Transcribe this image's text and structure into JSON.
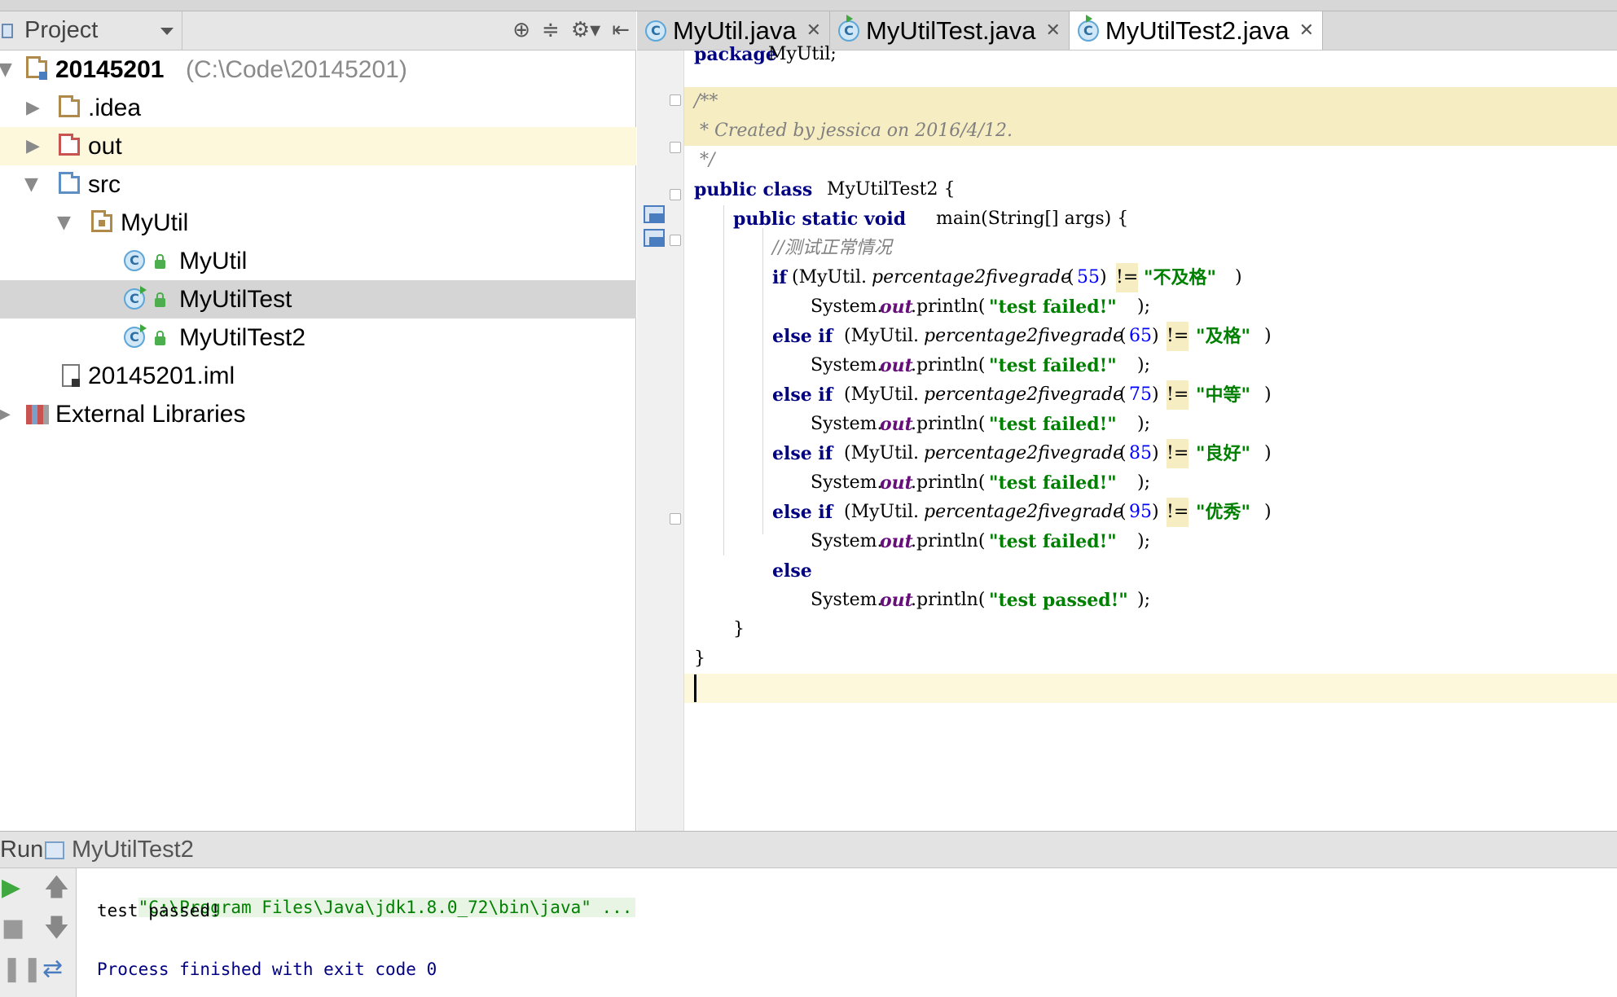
{
  "project_panel": {
    "title": "Project",
    "toolbar_icons": [
      "locate-icon",
      "collapse-icon",
      "gear-icon",
      "hide-icon"
    ],
    "tree": [
      {
        "label": "20145201",
        "path": "(C:\\Code\\20145201)",
        "type": "module-folder",
        "expanded": true
      },
      {
        "label": ".idea",
        "type": "folder",
        "expanded": false
      },
      {
        "label": "out",
        "type": "excluded-folder",
        "expanded": false,
        "highlighted": true
      },
      {
        "label": "src",
        "type": "source-folder",
        "expanded": true
      },
      {
        "label": "MyUtil",
        "type": "package",
        "expanded": true
      },
      {
        "label": "MyUtil",
        "type": "class"
      },
      {
        "label": "MyUtilTest",
        "type": "runnable-class",
        "selected": true
      },
      {
        "label": "MyUtilTest2",
        "type": "runnable-class"
      },
      {
        "label": "20145201.iml",
        "type": "iml-file"
      },
      {
        "label": "External Libraries",
        "type": "libraries",
        "expanded": false
      }
    ]
  },
  "editor_tabs": [
    {
      "label": "MyUtil.java",
      "icon": "class-icon",
      "active": false
    },
    {
      "label": "MyUtilTest.java",
      "icon": "runnable-class-icon",
      "active": false
    },
    {
      "label": "MyUtilTest2.java",
      "icon": "runnable-class-icon",
      "active": true
    }
  ],
  "code": {
    "l1_kw": "package",
    "l1_rest": " MyUtil;",
    "l3": "/**",
    "l4": " * Created by jessica on 2016/4/12.",
    "l5": " */",
    "l6_kw": "public class",
    "l6_rest": " MyUtilTest2 {",
    "l7_kw": "public static void",
    "l7_rest": " main(String[] args) {",
    "l8": "//测试正常情况",
    "if_kw": "if",
    "else_if_kw": "else if",
    "else_kw": "else",
    "call_prefix": "(MyUtil.",
    "method": "percentage2fivegrade",
    "neq": "!=",
    "conditions": [
      {
        "arg": "55",
        "grade": "\"不及格\""
      },
      {
        "arg": "65",
        "grade": "\"及格\""
      },
      {
        "arg": "75",
        "grade": "\"中等\""
      },
      {
        "arg": "85",
        "grade": "\"良好\""
      },
      {
        "arg": "95",
        "grade": "\"优秀\""
      }
    ],
    "sys_prefix": "System.",
    "out": "out",
    "println": ".println(",
    "failed": "\"test failed!\"",
    "passed": "\"test passed!\"",
    "stmt_end": ");",
    "close_paren": ")",
    "close_brace_inner": "}",
    "close_brace_outer": "}"
  },
  "run_panel": {
    "title": "Run",
    "config_name": "MyUtilTest2",
    "console": {
      "cmd": "\"C:\\Program Files\\Java\\jdk1.8.0_72\\bin\\java\" ...",
      "output": "test passed!",
      "exit": "Process finished with exit code 0"
    },
    "buttons": [
      "run-icon",
      "up-arrow-icon",
      "stop-icon",
      "down-arrow-icon",
      "pause-icon",
      "soft-wrap-icon"
    ]
  },
  "colors": {
    "keyword": "#000080",
    "string": "#008000",
    "number": "#0000ff",
    "comment": "#808080",
    "field": "#660e7a",
    "comment_bg": "#f6edc3",
    "current_line": "#fdf8dc",
    "selection": "#d5d5d5"
  }
}
